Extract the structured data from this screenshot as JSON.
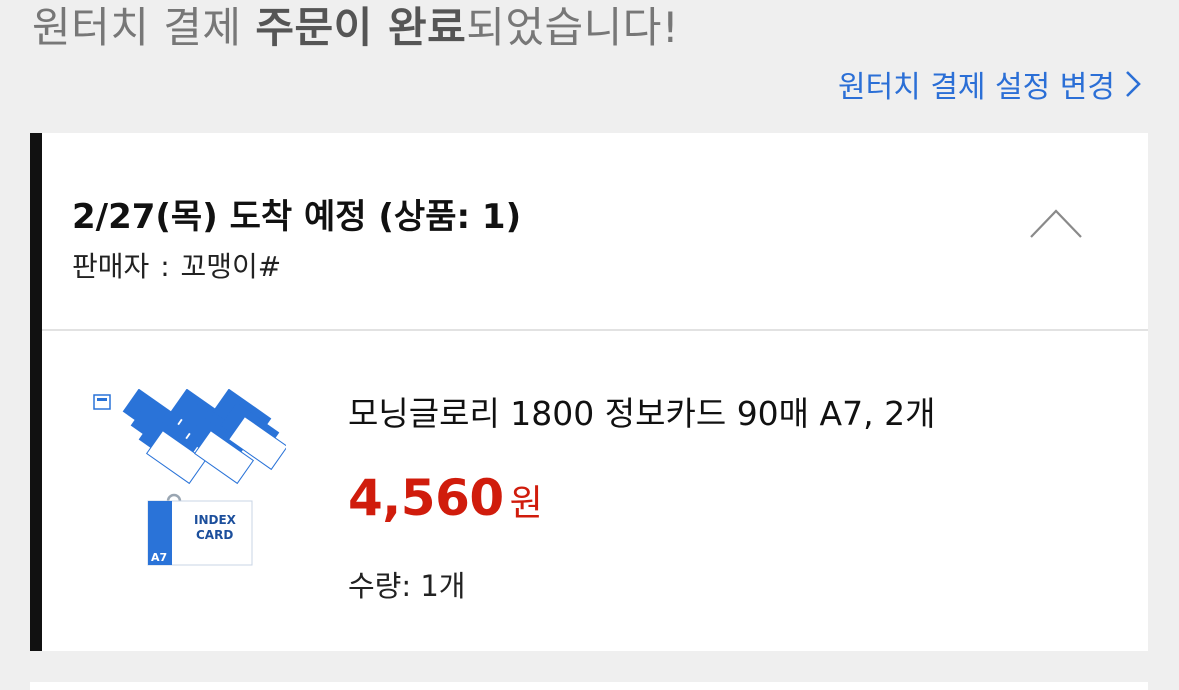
{
  "header": {
    "headline_prefix": "원터치 결제 ",
    "headline_bold": "주문이 완료",
    "headline_suffix": "되었습니다!",
    "settings_link": "원터치 결제 설정 변경"
  },
  "order": {
    "arrival_text": "2/27(목) 도착 예정 (상품: 1)",
    "seller_label": "판매자",
    "seller_separator": ":",
    "seller_name": "꼬맹이#",
    "items": [
      {
        "name": "모닝글로리 1800 정보카드 90매 A7, 2개",
        "price": "4,560",
        "currency": "원",
        "quantity_label": "수량:",
        "quantity_value": "1개",
        "image_text": {
          "title_line1": "INDEX",
          "title_line2": "CARD",
          "size": "A7"
        }
      }
    ]
  },
  "colors": {
    "background": "#efefef",
    "link": "#2b6fd6",
    "price": "#d01c0c",
    "accent_bar": "#111111",
    "card_blue": "#2a73d8"
  },
  "icons": {
    "settings_chevron": "chevron-right-icon",
    "collapse": "chevron-up-icon"
  }
}
